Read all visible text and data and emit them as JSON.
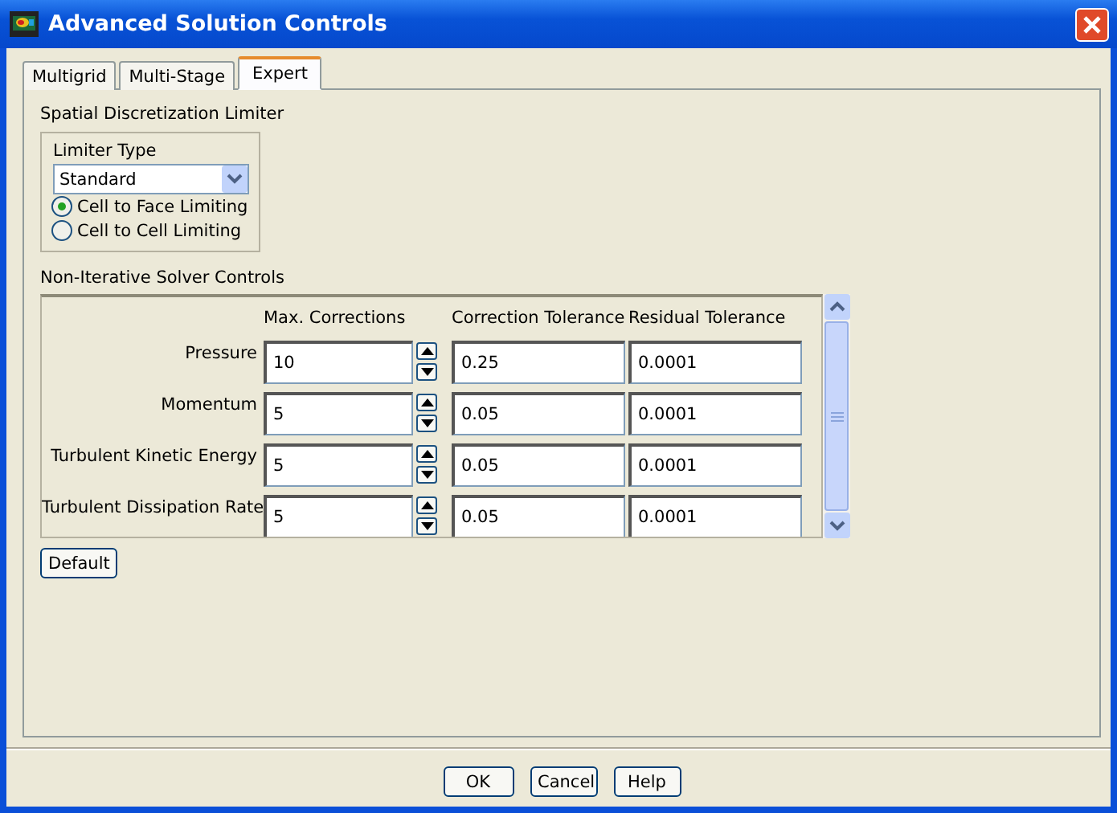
{
  "window": {
    "title": "Advanced Solution Controls"
  },
  "tabs": [
    {
      "label": "Multigrid",
      "selected": false
    },
    {
      "label": "Multi-Stage",
      "selected": false
    },
    {
      "label": "Expert",
      "selected": true
    }
  ],
  "limiter": {
    "group_label": "Spatial Discretization Limiter",
    "type_label": "Limiter Type",
    "type_value": "Standard",
    "options": [
      {
        "label": "Cell to Face Limiting",
        "selected": true
      },
      {
        "label": "Cell to Cell Limiting",
        "selected": false
      }
    ]
  },
  "solver": {
    "group_label": "Non-Iterative Solver Controls",
    "columns": [
      "Max. Corrections",
      "Correction Tolerance",
      "Residual Tolerance"
    ],
    "rows": [
      {
        "name": "Pressure",
        "max_corrections": "10",
        "correction_tolerance": "0.25",
        "residual_tolerance": "0.0001"
      },
      {
        "name": "Momentum",
        "max_corrections": "5",
        "correction_tolerance": "0.05",
        "residual_tolerance": "0.0001"
      },
      {
        "name": "Turbulent Kinetic Energy",
        "max_corrections": "5",
        "correction_tolerance": "0.05",
        "residual_tolerance": "0.0001"
      },
      {
        "name": "Turbulent Dissipation Rate",
        "max_corrections": "5",
        "correction_tolerance": "0.05",
        "residual_tolerance": "0.0001"
      }
    ]
  },
  "default_button": "Default",
  "buttons": [
    "OK",
    "Cancel",
    "Help"
  ]
}
